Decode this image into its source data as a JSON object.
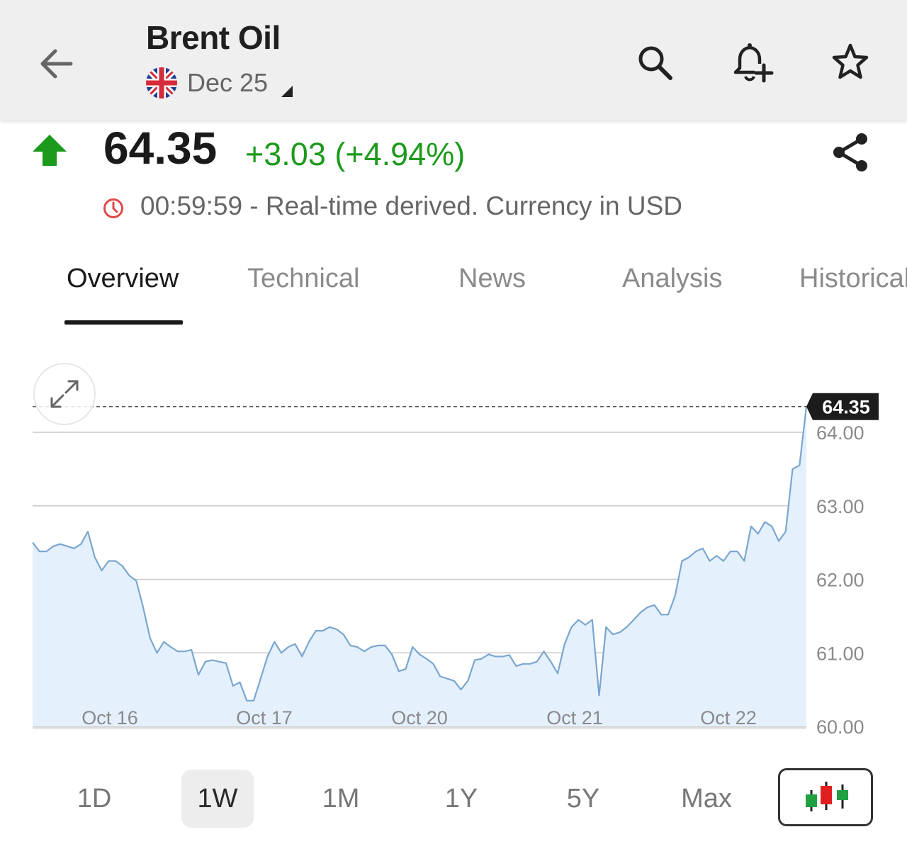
{
  "header": {
    "title": "Brent Oil",
    "contract": "Dec 25",
    "back_icon": "arrow-left-icon",
    "search_icon": "search-icon",
    "alert_icon": "bell-plus-icon",
    "watchlist_icon": "star-outline-icon",
    "flag_icon": "uk-flag-icon"
  },
  "quote": {
    "price": "64.35",
    "change": "+3.03 (+4.94%)",
    "timestamp": "00:59:59 - Real-time derived. Currency in USD",
    "direction": "up",
    "up_color": "#1c9a1c",
    "clock_color": "#e04848"
  },
  "tabs": [
    {
      "label": "Overview",
      "active": true
    },
    {
      "label": "Technical",
      "active": false
    },
    {
      "label": "News",
      "active": false
    },
    {
      "label": "Analysis",
      "active": false
    },
    {
      "label": "Historical",
      "active": false
    }
  ],
  "chart_data": {
    "type": "area",
    "x_tick_labels": [
      "Oct 16",
      "Oct 17",
      "Oct 20",
      "Oct 21",
      "Oct 22"
    ],
    "y_tick_labels": [
      "64.00",
      "63.00",
      "62.00",
      "61.00",
      "60.00"
    ],
    "ylim": [
      60.0,
      64.35
    ],
    "current_value_label": "64.35",
    "current_value": 64.35,
    "grid": true,
    "line_color": "#7aa6d0",
    "fill_color": "#e4f0fc",
    "values": [
      62.5,
      62.38,
      62.38,
      62.45,
      62.48,
      62.45,
      62.42,
      62.48,
      62.65,
      62.3,
      62.12,
      62.25,
      62.25,
      62.18,
      62.05,
      61.98,
      61.62,
      61.2,
      61.0,
      61.15,
      61.08,
      61.02,
      61.02,
      61.04,
      60.7,
      60.88,
      60.9,
      60.88,
      60.86,
      60.55,
      60.6,
      60.35,
      60.35,
      60.65,
      60.95,
      61.15,
      61.0,
      61.08,
      61.12,
      60.95,
      61.15,
      61.3,
      61.3,
      61.35,
      61.32,
      61.25,
      61.1,
      61.08,
      61.02,
      61.08,
      61.1,
      61.1,
      60.98,
      60.75,
      60.78,
      61.08,
      60.98,
      60.92,
      60.85,
      60.68,
      60.65,
      60.62,
      60.5,
      60.62,
      60.9,
      60.92,
      60.98,
      60.95,
      60.95,
      60.97,
      60.82,
      60.85,
      60.85,
      60.88,
      61.02,
      60.88,
      60.72,
      61.12,
      61.35,
      61.45,
      61.38,
      61.45,
      60.42,
      61.35,
      61.25,
      61.28,
      61.35,
      61.45,
      61.55,
      61.62,
      61.65,
      61.52,
      61.52,
      61.78,
      62.25,
      62.3,
      62.38,
      62.42,
      62.25,
      62.32,
      62.25,
      62.38,
      62.38,
      62.25,
      62.72,
      62.62,
      62.78,
      62.72,
      62.52,
      62.65,
      63.5,
      63.55,
      64.35
    ]
  },
  "ranges": [
    {
      "label": "1D",
      "active": false
    },
    {
      "label": "1W",
      "active": true
    },
    {
      "label": "1M",
      "active": false
    },
    {
      "label": "1Y",
      "active": false
    },
    {
      "label": "5Y",
      "active": false
    },
    {
      "label": "Max",
      "active": false
    }
  ],
  "chart_controls": {
    "expand_icon": "expand-icon",
    "chart_type_icon": "candlestick-icon",
    "share_icon": "share-icon"
  }
}
